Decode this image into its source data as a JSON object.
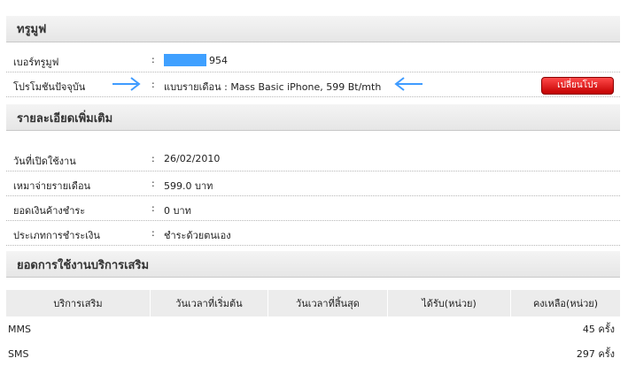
{
  "truemove_section": {
    "title": "ทรูมูฟ"
  },
  "phone_row": {
    "label": "เบอร์ทรูมูฟ",
    "colon": ":",
    "value": "954"
  },
  "promo_row": {
    "label": "โปรโมชันปัจจุบัน",
    "colon": ":",
    "value": "แบบรายเดือน : Mass Basic iPhone, 599 Bt/mth",
    "change_button": "เปลี่ยนโปร"
  },
  "details_section": {
    "title": "รายละเอียดเพิ่มเติม"
  },
  "details": [
    {
      "label": "วันที่เปิดใช้งาน",
      "value": "26/02/2010"
    },
    {
      "label": "เหมาจ่ายรายเดือน",
      "value": "599.0 บาท"
    },
    {
      "label": "ยอดเงินค้างชำระ",
      "value": "0 บาท"
    },
    {
      "label": "ประเภทการชำระเงิน",
      "value": "ชำระด้วยตนเอง"
    }
  ],
  "usage_section": {
    "title": "ยอดการใช้งานบริการเสริม"
  },
  "usage_table": {
    "headers": [
      "บริการเสริม",
      "วันเวลาที่เริ่มต้น",
      "วันเวลาที่สิ้นสุด",
      "ได้รับ(หน่วย)",
      "คงเหลือ(หน่วย)"
    ],
    "rows": [
      {
        "service": "MMS",
        "start": "",
        "end": "",
        "received": "",
        "remaining": "45 ครั้ง"
      },
      {
        "service": "SMS",
        "start": "",
        "end": "",
        "received": "",
        "remaining": "297 ครั้ง"
      }
    ]
  },
  "colors": {
    "mask": "#3fa0ff",
    "arrow": "#3f9bff",
    "button": "#d40000"
  },
  "icons": {
    "arrow_left": "arrow-right-icon",
    "arrow_right": "arrow-left-icon"
  }
}
